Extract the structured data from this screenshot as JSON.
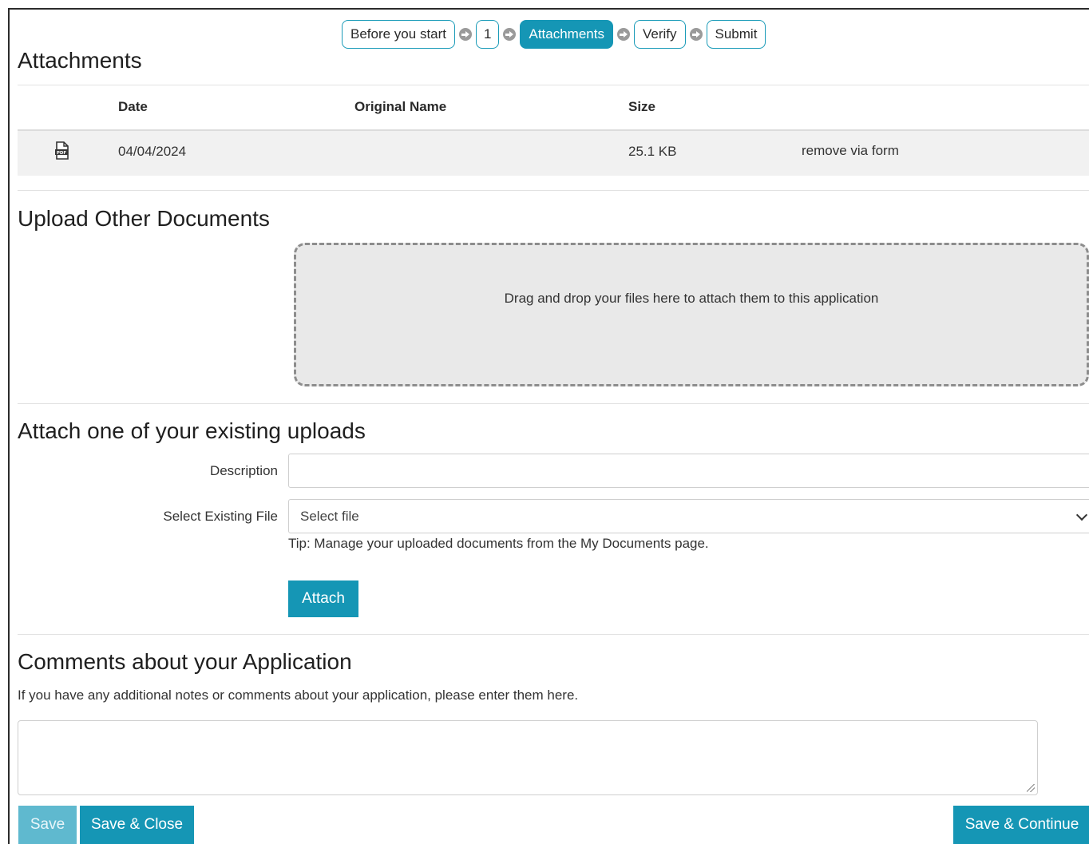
{
  "stepper": {
    "steps": [
      {
        "label": "Before you start",
        "active": false
      },
      {
        "label": "1",
        "active": false
      },
      {
        "label": "Attachments",
        "active": true
      },
      {
        "label": "Verify",
        "active": false
      },
      {
        "label": "Submit",
        "active": false
      }
    ],
    "arrow_icon": "circle-arrow-right-icon"
  },
  "attachments": {
    "title": "Attachments",
    "columns": [
      "Date",
      "Original Name",
      "Size"
    ],
    "rows": [
      {
        "icon": "pdf-file-icon",
        "date": "04/04/2024",
        "original_name": "",
        "size": "25.1 KB",
        "action": "remove via form"
      }
    ]
  },
  "upload": {
    "title": "Upload Other Documents",
    "dropzone_text": "Drag and drop your files here to attach them to this application"
  },
  "existing": {
    "title": "Attach one of your existing uploads",
    "description_label": "Description",
    "description_value": "",
    "file_label": "Select Existing File",
    "file_selected": "Select file",
    "tip": "Tip: Manage your uploaded documents from the My Documents page.",
    "attach_label": "Attach"
  },
  "comments": {
    "title": "Comments about your Application",
    "help": "If you have any additional notes or comments about your application, please enter them here.",
    "value": ""
  },
  "footer": {
    "save_label": "Save",
    "save_close_label": "Save & Close",
    "save_continue_label": "Save & Continue"
  },
  "colors": {
    "accent": "#1596b5",
    "accent_disabled": "#5fb9cf",
    "dropzone_bg": "#e9e9e9"
  }
}
